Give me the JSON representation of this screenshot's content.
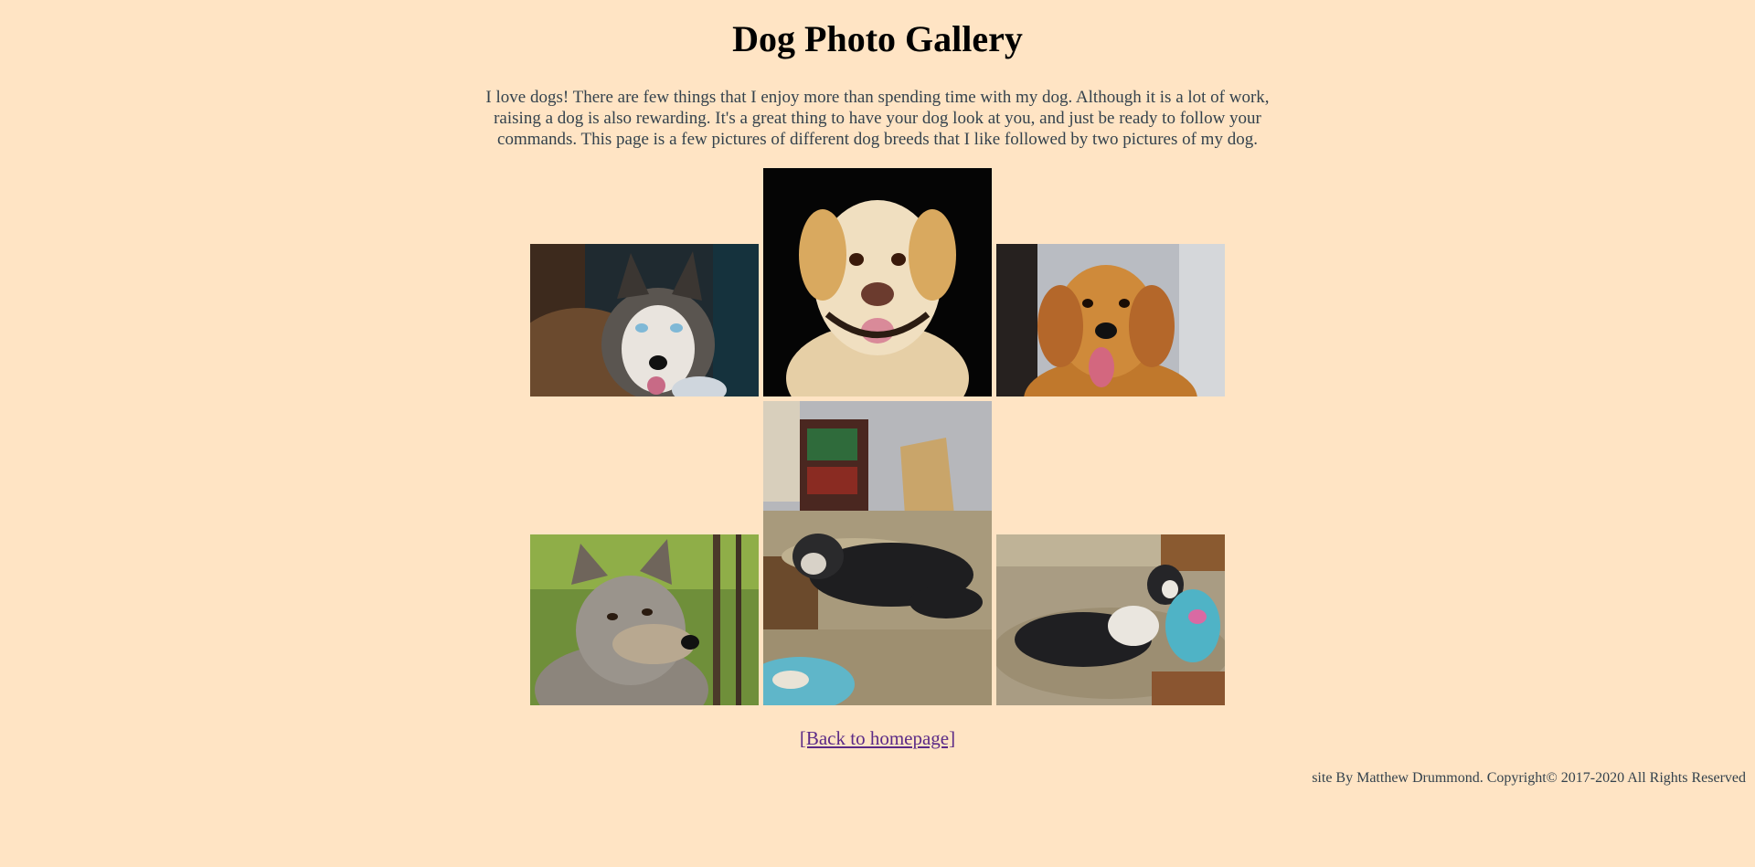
{
  "page": {
    "title": "Dog Photo Gallery",
    "intro": "I love dogs! There are few things that I enjoy more than spending time with my dog. Although it is a lot of work, raising a dog is also rewarding. It's a great thing to have your dog look at you, and just be ready to follow your commands. This page is a few pictures of different dog breeds that I like followed by two pictures of my dog."
  },
  "gallery": {
    "photos": [
      {
        "subject": "husky"
      },
      {
        "subject": "yellow labrador"
      },
      {
        "subject": "golden retriever"
      },
      {
        "subject": "wolf"
      },
      {
        "subject": "dog sleeping on armchair"
      },
      {
        "subject": "dog lying on couch"
      }
    ]
  },
  "nav": {
    "back_label": "[Back to homepage]"
  },
  "footer": {
    "text": "site By Matthew Drummond. Copyright© 2017-2020 All Rights Reserved"
  },
  "colors": {
    "background": "#ffe4c4",
    "link": "#5b2a86"
  }
}
